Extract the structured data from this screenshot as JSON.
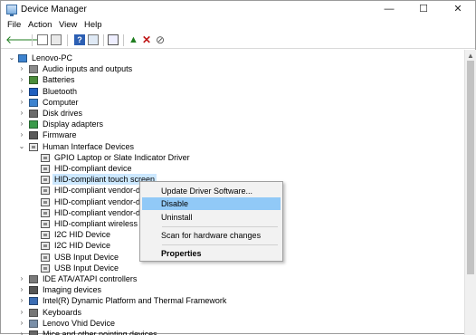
{
  "window": {
    "title": "Device Manager",
    "controls": {
      "minimize": "—",
      "maximize": "☐",
      "close": "✕"
    }
  },
  "menu": [
    "File",
    "Action",
    "View",
    "Help"
  ],
  "toolbar": [
    "back-arrow-icon",
    "forward-arrow-icon",
    "show-hide-tree-icon",
    "properties-icon",
    "help-icon",
    "device-properties-icon",
    "scan-hardware-icon",
    "update-driver-icon",
    "uninstall-icon",
    "disable-icon"
  ],
  "tree": {
    "root": "Lenovo-PC",
    "categories": [
      {
        "label": "Audio inputs and outputs",
        "icon": "speaker-icon"
      },
      {
        "label": "Batteries",
        "icon": "battery-icon"
      },
      {
        "label": "Bluetooth",
        "icon": "bluetooth-icon"
      },
      {
        "label": "Computer",
        "icon": "computer-icon"
      },
      {
        "label": "Disk drives",
        "icon": "disk-drive-icon"
      },
      {
        "label": "Display adapters",
        "icon": "display-adapter-icon"
      },
      {
        "label": "Firmware",
        "icon": "firmware-icon"
      }
    ],
    "hid": {
      "label": "Human Interface Devices",
      "children": [
        "GPIO Laptop or Slate Indicator Driver",
        "HID-compliant device",
        "HID-compliant touch screen",
        "HID-compliant vendor-defi",
        "HID-compliant vendor-defi",
        "HID-compliant vendor-defi",
        "HID-compliant wireless rad",
        "I2C HID Device",
        "I2C HID Device",
        "USB Input Device",
        "USB Input Device"
      ],
      "selected_index": 2
    },
    "categories_after": [
      {
        "label": "IDE ATA/ATAPI controllers",
        "icon": "ide-controller-icon"
      },
      {
        "label": "Imaging devices",
        "icon": "camera-icon"
      },
      {
        "label": "Intel(R) Dynamic Platform and Thermal Framework",
        "icon": "chip-icon"
      },
      {
        "label": "Keyboards",
        "icon": "keyboard-icon"
      },
      {
        "label": "Lenovo Vhid Device",
        "icon": "device-icon"
      },
      {
        "label": "Mice and other pointing devices",
        "icon": "mouse-icon"
      }
    ]
  },
  "context_menu": {
    "items": [
      "Update Driver Software...",
      "Disable",
      "Uninstall",
      "Scan for hardware changes",
      "Properties"
    ],
    "highlighted": "Disable"
  },
  "colors": {
    "selection": "#cce8ff",
    "menu_highlight": "#91c9f7",
    "accent": "#3a6ea5"
  }
}
